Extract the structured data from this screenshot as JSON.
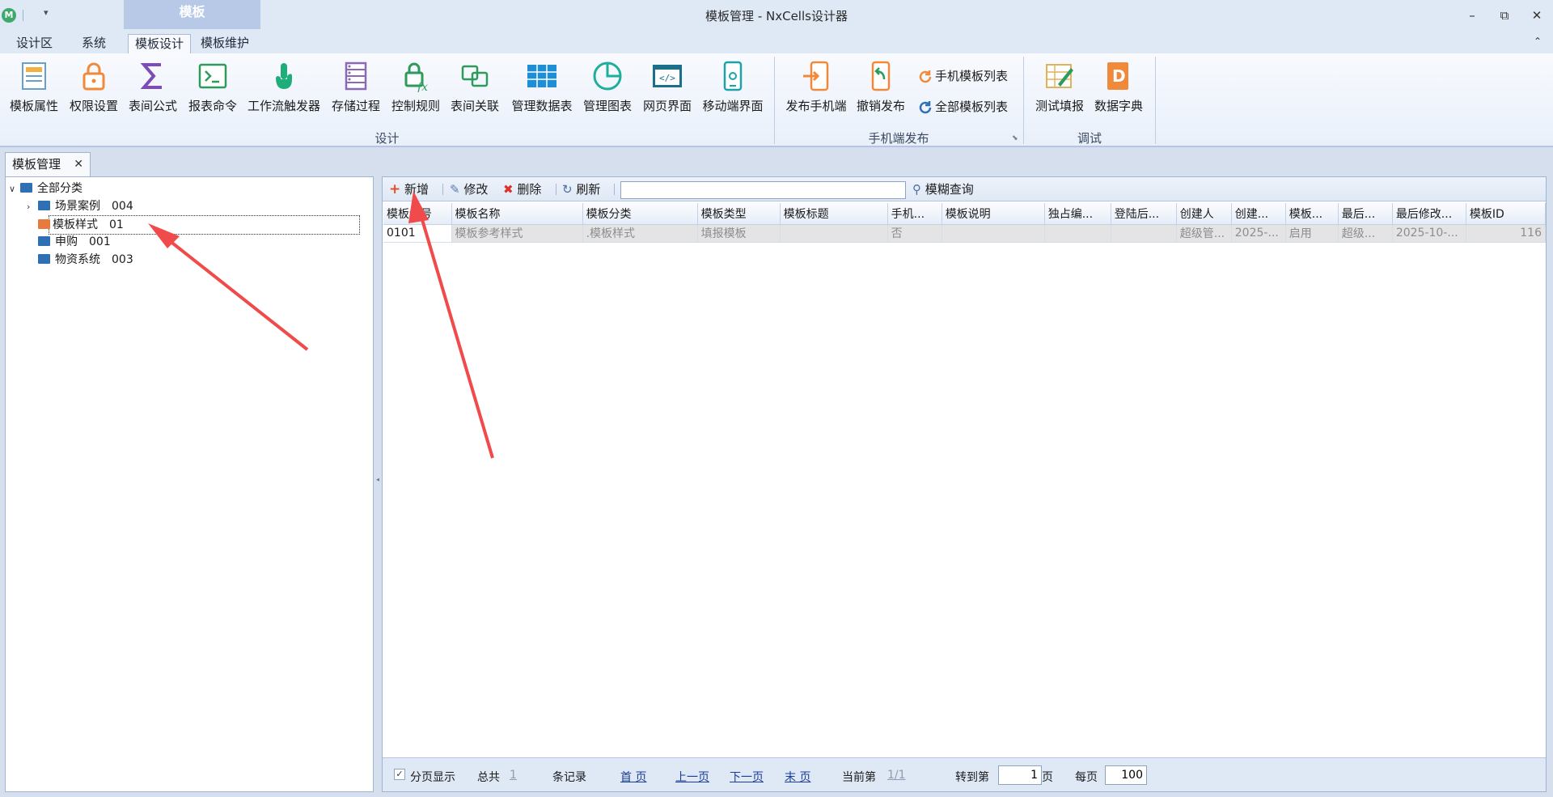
{
  "window": {
    "title": "模板管理 - NxCells设计器",
    "context_tab_group": "模板"
  },
  "ribbon_tabs": [
    "设计区",
    "系统",
    "模板设计",
    "模板维护"
  ],
  "ribbon": {
    "design_group": {
      "label": "设计",
      "buttons": [
        "模板属性",
        "权限设置",
        "表间公式",
        "报表命令",
        "工作流触发器",
        "存储过程",
        "控制规则",
        "表间关联",
        "管理数据表",
        "管理图表",
        "网页界面",
        "移动端界面"
      ]
    },
    "mobile_group": {
      "label": "手机端发布",
      "buttons": [
        "发布手机端",
        "撤销发布"
      ],
      "small_buttons": [
        "手机模板列表",
        "全部模板列表"
      ]
    },
    "debug_group": {
      "label": "调试",
      "buttons": [
        "测试填报",
        "数据字典"
      ]
    }
  },
  "doc_tab": {
    "label": "模板管理"
  },
  "tree": {
    "root": "全部分类",
    "items": [
      {
        "name": "场景案例",
        "code": "004"
      },
      {
        "name": "模板样式",
        "code": "01"
      },
      {
        "name": "申购",
        "code": "001"
      },
      {
        "name": "物资系统",
        "code": "003"
      }
    ]
  },
  "toolbar": {
    "add": "新增",
    "edit": "修改",
    "delete": "删除",
    "refresh": "刷新",
    "search_value": "",
    "fuzzy_search": "模糊查询"
  },
  "grid": {
    "columns": [
      "模板编号",
      "模板名称",
      "模板分类",
      "模板类型",
      "模板标题",
      "手机...",
      "模板说明",
      "独占编...",
      "登陆后...",
      "创建人",
      "创建...",
      "模板...",
      "最后...",
      "最后修改...",
      "模板ID"
    ],
    "rows": [
      [
        "0101",
        "模板参考样式",
        ".模板样式",
        "填报模板",
        "",
        "否",
        "",
        "",
        "",
        "超级管...",
        "2025-...",
        "启用",
        "超级...",
        "2025-10-...",
        "116"
      ]
    ]
  },
  "pager": {
    "paged_display": "分页显示",
    "total_label": "总共",
    "total": "1",
    "records": "条记录",
    "first": "首 页",
    "prev": "上一页",
    "next": "下一页",
    "last": "末 页",
    "current_label": "当前第",
    "current": "1/1",
    "goto_label": "转到第",
    "goto_value": "1",
    "page_unit": "页",
    "per_page_label": "每页",
    "per_page_value": "100"
  },
  "colors": {
    "accent": "#2f6fb4",
    "annotation_arrow": "#f04a4a"
  }
}
